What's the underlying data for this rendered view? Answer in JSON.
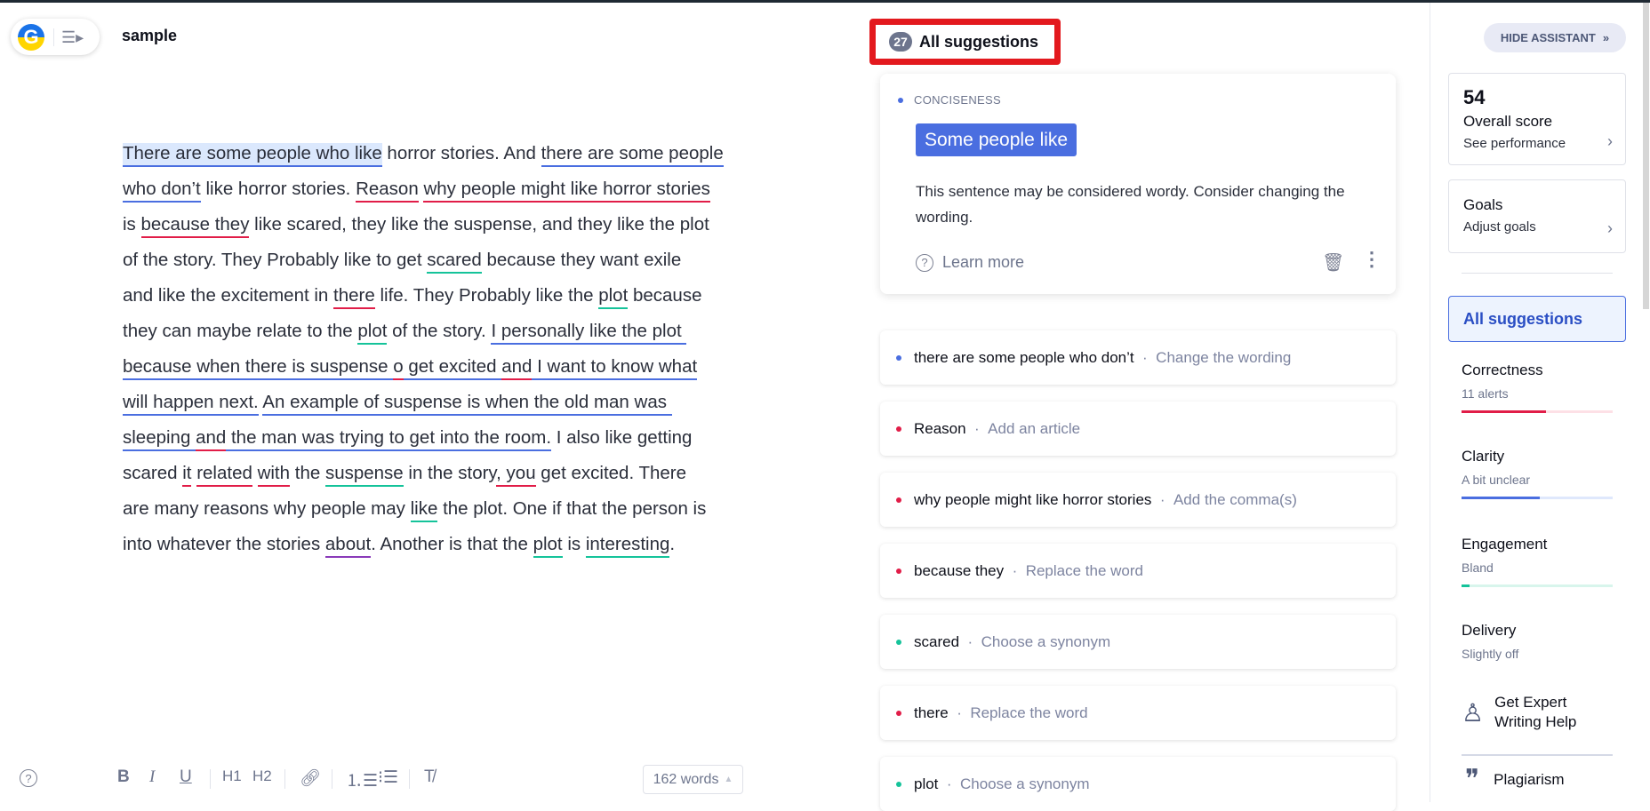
{
  "doc": {
    "title": "sample",
    "logo_letter": "G"
  },
  "editor": {
    "lines": [
      [
        {
          "t": "There are some people who like",
          "u": "blue",
          "hl": true
        },
        {
          "t": " horror stories. And "
        },
        {
          "t": "there are some people",
          "u": "blue"
        }
      ],
      [
        {
          "t": "who don’t",
          "u": "blue"
        },
        {
          "t": " like horror stories. "
        },
        {
          "t": "Reason",
          "u": "red"
        },
        {
          "t": " "
        },
        {
          "t": "why people might like horror stories",
          "u": "red"
        }
      ],
      [
        {
          "t": "is "
        },
        {
          "t": "because they",
          "u": "red"
        },
        {
          "t": " like scared, they like the suspense, and they like the plot"
        }
      ],
      [
        {
          "t": "of the story. They Probably like to get "
        },
        {
          "t": "scared",
          "u": "green"
        },
        {
          "t": " because they want exile"
        }
      ],
      [
        {
          "t": "and like the excitement in "
        },
        {
          "t": "there",
          "u": "red"
        },
        {
          "t": " life. They Probably like the "
        },
        {
          "t": "plot",
          "u": "green"
        },
        {
          "t": " because"
        }
      ],
      [
        {
          "t": "they can maybe relate to the "
        },
        {
          "t": "plot",
          "u": "green"
        },
        {
          "t": " of the story. "
        },
        {
          "t": "I personally like the plot ",
          "u": "blue"
        }
      ],
      [
        {
          "t": "because when there is suspense ",
          "u": "blue"
        },
        {
          "t": "o",
          "u": "red"
        },
        {
          "t": " get excited ",
          "u": "blue"
        },
        {
          "t": "and",
          "u": "red"
        },
        {
          "t": " I want to know what",
          "u": "blue"
        }
      ],
      [
        {
          "t": "will happen next.",
          "u": "blue"
        },
        {
          "t": " "
        },
        {
          "t": "An example of suspense is when the old man was ",
          "u": "blue"
        }
      ],
      [
        {
          "t": "sleeping ",
          "u": "blue"
        },
        {
          "t": "and",
          "u": "red"
        },
        {
          "t": " the man was trying to get into the room.",
          "u": "blue"
        },
        {
          "t": " I also like getting"
        }
      ],
      [
        {
          "t": "scared "
        },
        {
          "t": "it",
          "u": "red"
        },
        {
          "t": " "
        },
        {
          "t": "related",
          "u": "red"
        },
        {
          "t": " "
        },
        {
          "t": "with",
          "u": "red"
        },
        {
          "t": " the "
        },
        {
          "t": "suspense",
          "u": "green"
        },
        {
          "t": " in the story"
        },
        {
          "t": ", you",
          "u": "red"
        },
        {
          "t": " get excited. There"
        }
      ],
      [
        {
          "t": "are many reasons why people may "
        },
        {
          "t": "like",
          "u": "green"
        },
        {
          "t": " the plot. One if that the person is"
        }
      ],
      [
        {
          "t": "into whatever the stories "
        },
        {
          "t": "about",
          "u": "purple"
        },
        {
          "t": ". Another is that the "
        },
        {
          "t": "plot",
          "u": "green"
        },
        {
          "t": " is "
        },
        {
          "t": "interesting",
          "u": "green"
        },
        {
          "t": "."
        }
      ]
    ]
  },
  "toolbar": {
    "bold": "B",
    "italic": "I",
    "underline": "U",
    "h1": "H1",
    "h2": "H2",
    "word_count": "162 words"
  },
  "suggestions": {
    "count": "27",
    "title": "All suggestions",
    "active": {
      "category": "CONCISENESS",
      "replacement": "Some people like",
      "description": "This sentence may be considered wordy. Consider changing the wording.",
      "learn_more": "Learn more"
    },
    "items": [
      {
        "text": "there are some people who don’t",
        "hint": "Change the wording",
        "color": "#4a6ee0"
      },
      {
        "text": "Reason",
        "hint": "Add an article",
        "color": "#e11d48"
      },
      {
        "text": "why people might like horror stories",
        "hint": "Add the comma(s)",
        "color": "#e11d48"
      },
      {
        "text": "because they",
        "hint": "Replace the word",
        "color": "#e11d48"
      },
      {
        "text": "scared",
        "hint": "Choose a synonym",
        "color": "#15c39a"
      },
      {
        "text": "there",
        "hint": "Replace the word",
        "color": "#e11d48"
      },
      {
        "text": "plot",
        "hint": "Choose a synonym",
        "color": "#15c39a"
      }
    ]
  },
  "sidebar": {
    "hide_label": "HIDE ASSISTANT",
    "score": "54",
    "score_label": "Overall score",
    "score_link": "See performance",
    "goals": "Goals",
    "goals_link": "Adjust goals",
    "all_suggestions": "All suggestions",
    "categories": [
      {
        "name": "Correctness",
        "status": "11 alerts",
        "fill": 0.56,
        "color": "#e11d48",
        "track": "#fde0e6"
      },
      {
        "name": "Clarity",
        "status": "A bit unclear",
        "fill": 0.52,
        "color": "#4a6ee0",
        "track": "#dfe8fc"
      },
      {
        "name": "Engagement",
        "status": "Bland",
        "fill": 0.05,
        "color": "#15c39a",
        "track": "#d8f5ec"
      },
      {
        "name": "Delivery",
        "status": "Slightly off"
      }
    ],
    "expert": "Get Expert Writing Help",
    "plagiarism": "Plagiarism"
  }
}
